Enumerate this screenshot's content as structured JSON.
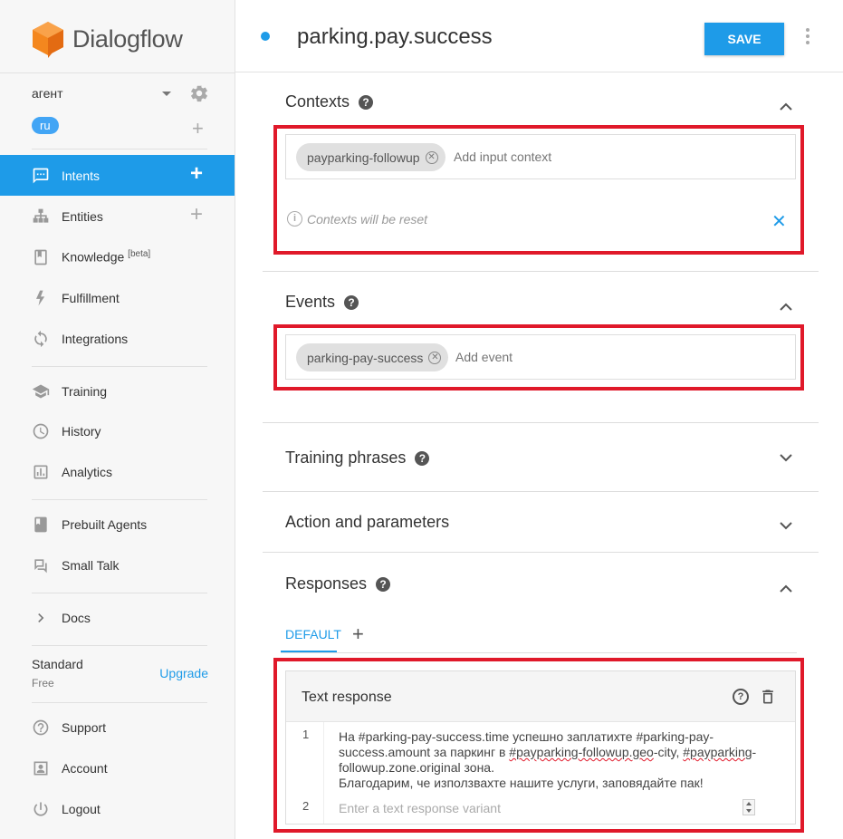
{
  "brand": {
    "name": "Dialogflow",
    "logo_color": "#f4871e"
  },
  "agent": {
    "name": "агент",
    "language": "ru"
  },
  "sidebar": {
    "items": [
      {
        "label": "Intents",
        "icon": "chat-icon",
        "active": true
      },
      {
        "label": "Entities",
        "icon": "hierarchy-icon"
      },
      {
        "label": "Knowledge",
        "badge": "[beta]",
        "icon": "book-icon"
      },
      {
        "label": "Fulfillment",
        "icon": "bolt-icon"
      },
      {
        "label": "Integrations",
        "icon": "sync-icon"
      },
      {
        "label": "Training",
        "icon": "graduation-cap-icon"
      },
      {
        "label": "History",
        "icon": "clock-icon"
      },
      {
        "label": "Analytics",
        "icon": "bar-chart-icon"
      },
      {
        "label": "Prebuilt Agents",
        "icon": "bookmark-book-icon"
      },
      {
        "label": "Small Talk",
        "icon": "chat-bubbles-icon"
      },
      {
        "label": "Docs",
        "icon": "chevron-right-icon"
      },
      {
        "label": "Support",
        "icon": "help-circle-icon"
      },
      {
        "label": "Account",
        "icon": "person-box-icon"
      },
      {
        "label": "Logout",
        "icon": "power-icon"
      }
    ],
    "plan": {
      "name": "Standard",
      "sub": "Free",
      "upgrade_label": "Upgrade"
    }
  },
  "header": {
    "intent_name": "parking.pay.success",
    "save_label": "SAVE"
  },
  "sections": {
    "contexts": {
      "title": "Contexts",
      "chip": "payparking-followup",
      "placeholder": "Add input context",
      "note": "Contexts will be reset"
    },
    "events": {
      "title": "Events",
      "chip": "parking-pay-success",
      "placeholder": "Add event"
    },
    "training": {
      "title": "Training phrases"
    },
    "action": {
      "title": "Action and parameters"
    },
    "responses": {
      "title": "Responses",
      "tab": "DEFAULT",
      "card_title": "Text response",
      "line1_no": "1",
      "line2_no": "2",
      "text": {
        "a": "На #parking-pay-success.time успешно заплатихте #parking-pay-success.amount за паркинг в ",
        "b": "#payparking-followup.geo",
        "c": "-city, ",
        "d": "#payparking",
        "e": "-followup.zone.original зона.",
        "f": "Благодарим, че използвахте нашите услуги, заповядайте пак!"
      },
      "placeholder": "Enter a text response variant"
    }
  },
  "colors": {
    "accent": "#1e9be8",
    "highlight_box": "#e0192a"
  }
}
